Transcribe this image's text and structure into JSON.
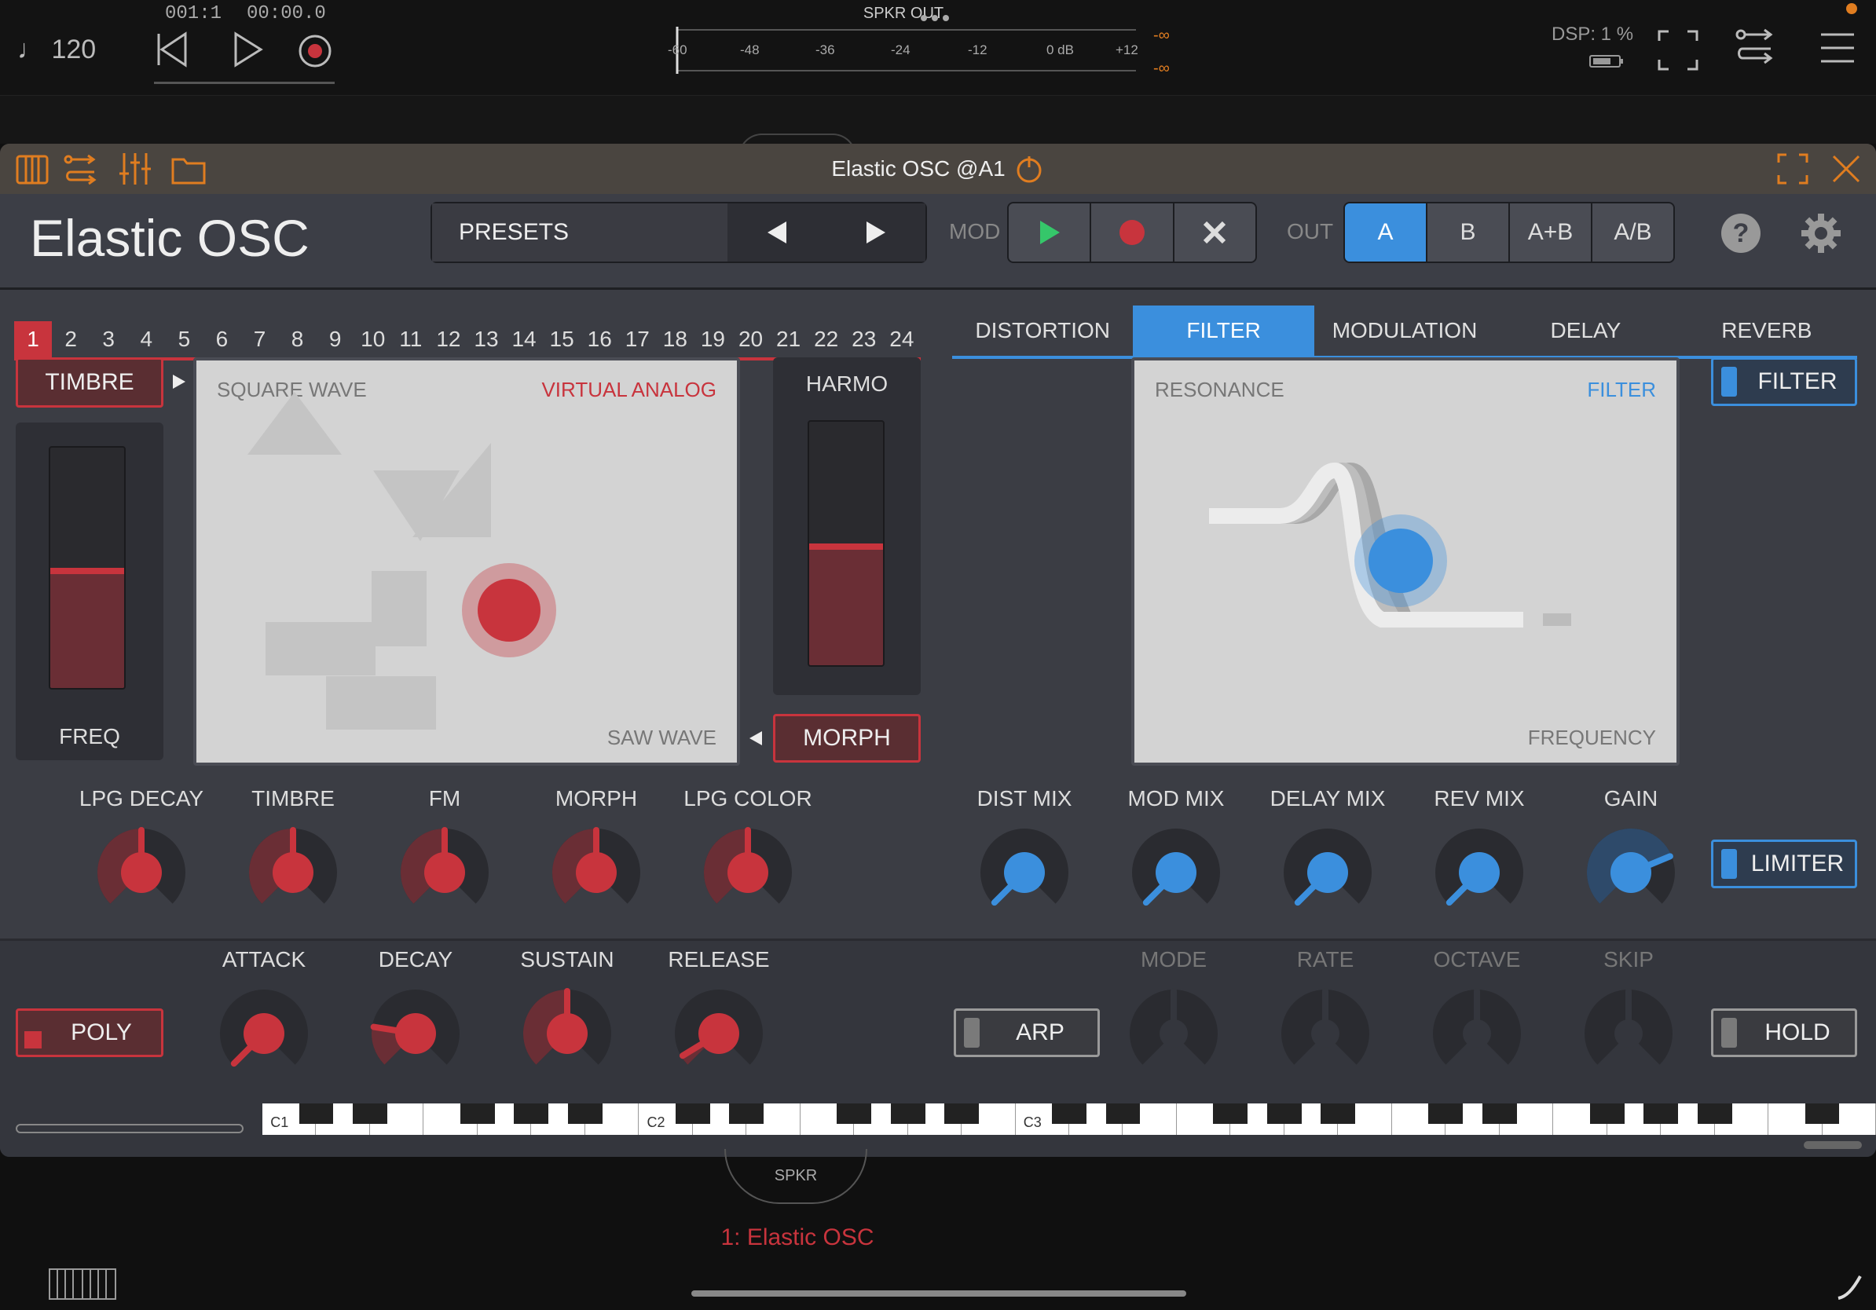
{
  "host": {
    "tempo": "120",
    "position": "001:1",
    "time": "00:00.0",
    "meter_title": "SPKR OUT",
    "meter_scale": [
      "-60",
      "-48",
      "-36",
      "-24",
      "-12",
      "0 dB",
      "+12"
    ],
    "meter_peak_top": "-∞",
    "meter_peak_bottom": "-∞",
    "dsp": "DSP:  1 %",
    "track_label": "1: Elastic OSC",
    "output_node": "SPKR"
  },
  "plugin": {
    "window_title": "Elastic OSC @A1",
    "name": "Elastic OSC",
    "presets_label": "PRESETS",
    "mod_label": "MOD",
    "out_label": "OUT",
    "out_options": [
      "A",
      "B",
      "A+B",
      "A/B"
    ],
    "out_selected": "A",
    "steps": [
      "1",
      "2",
      "3",
      "4",
      "5",
      "6",
      "7",
      "8",
      "9",
      "10",
      "11",
      "12",
      "13",
      "14",
      "15",
      "16",
      "17",
      "18",
      "19",
      "20",
      "21",
      "22",
      "23",
      "24"
    ],
    "active_step": "1",
    "fx_tabs": [
      "DISTORTION",
      "FILTER",
      "MODULATION",
      "DELAY",
      "REVERB"
    ],
    "fx_active_tab": "FILTER",
    "timbre_button": "TIMBRE",
    "freq_label": "FREQ",
    "freq_level": 0.5,
    "harmo_label": "HARMO",
    "harmo_level": 0.5,
    "morph_button": "MORPH",
    "osc_pad": {
      "top_left": "SQUARE WAVE",
      "top_right": "VIRTUAL ANALOG",
      "bottom_right": "SAW WAVE"
    },
    "filter_pad": {
      "top_left": "RESONANCE",
      "top_right": "FILTER",
      "bottom_right": "FREQUENCY"
    },
    "filter_toggle": "FILTER",
    "limiter_toggle": "LIMITER",
    "osc_knobs": [
      {
        "label": "LPG DECAY",
        "value": 0.5
      },
      {
        "label": "TIMBRE",
        "value": 0.5
      },
      {
        "label": "FM",
        "value": 0.5
      },
      {
        "label": "MORPH",
        "value": 0.5
      },
      {
        "label": "LPG COLOR",
        "value": 0.5
      }
    ],
    "fx_knobs": [
      {
        "label": "DIST MIX",
        "value": 0.0
      },
      {
        "label": "MOD MIX",
        "value": 0.0
      },
      {
        "label": "DELAY MIX",
        "value": 0.0
      },
      {
        "label": "REV MIX",
        "value": 0.0
      },
      {
        "label": "GAIN",
        "value": 0.75
      }
    ],
    "poly_button": "POLY",
    "env_knobs": [
      {
        "label": "ATTACK",
        "value": 0.0
      },
      {
        "label": "DECAY",
        "value": 0.2
      },
      {
        "label": "SUSTAIN",
        "value": 0.5
      },
      {
        "label": "RELEASE",
        "value": 0.05
      }
    ],
    "arp_button": "ARP",
    "arp_knobs": [
      "MODE",
      "RATE",
      "OCTAVE",
      "SKIP"
    ],
    "hold_button": "HOLD",
    "keyboard_labels": [
      "C1",
      "C2",
      "C3"
    ]
  },
  "colors": {
    "accent_red": "#c8343d",
    "accent_blue": "#3b8fdd",
    "play_green": "#35c76a",
    "host_orange": "#e07d20"
  }
}
